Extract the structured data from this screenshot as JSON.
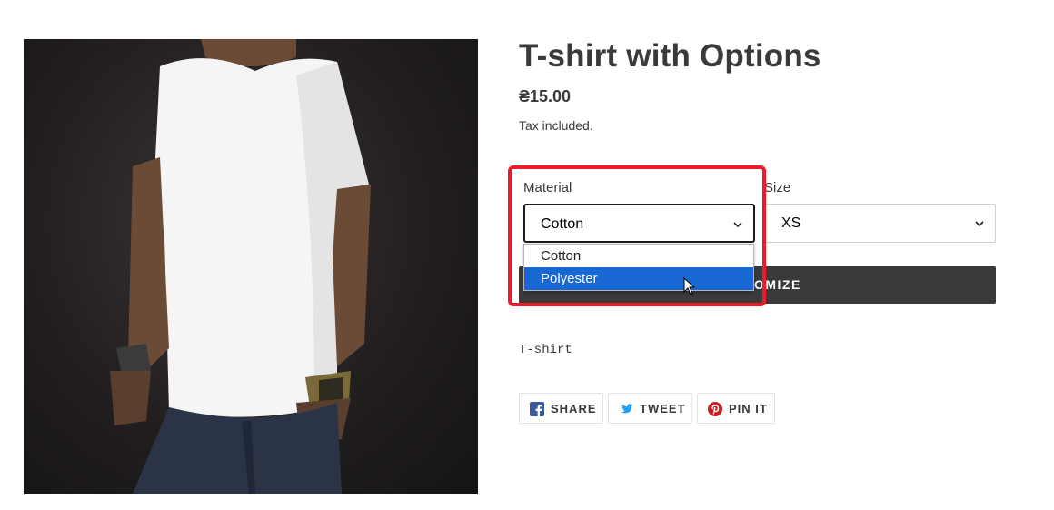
{
  "product": {
    "title": "T-shirt with Options",
    "price": "₴15.00",
    "tax_note": "Tax included.",
    "description": "T-shirt"
  },
  "options": {
    "material": {
      "label": "Material",
      "selected": "Cotton",
      "dropdown_open": true,
      "options": [
        "Cotton",
        "Polyester"
      ],
      "hovered": "Polyester"
    },
    "size": {
      "label": "Size",
      "selected": "XS"
    }
  },
  "add_to_cart": {
    "visible_label": "OMIZE"
  },
  "share": {
    "facebook": "SHARE",
    "twitter": "TWEET",
    "pinterest": "PIN IT"
  },
  "colors": {
    "highlight": "#ee1c2b",
    "dropdown_active": "#1967d2",
    "button_bg": "#3a3a3a"
  }
}
